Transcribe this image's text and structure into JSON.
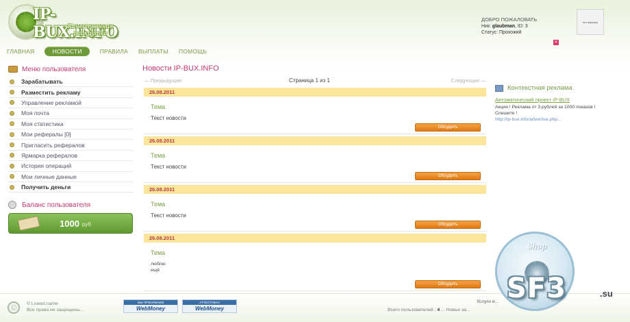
{
  "header": {
    "logo_text": "IP-BUX.INFO",
    "logo_tagline": "Качественная раскрутка",
    "welcome_title": "ДОБРО ПОЖАЛОВАТЬ",
    "user_line": [
      "Ник: ",
      "glaubman",
      ", ID: 3"
    ],
    "status_line": "Статус: Прохожий",
    "avatar_text": "нет аватара",
    "logout_symbol": "✕"
  },
  "nav": {
    "items": [
      "ГЛАВНАЯ",
      "НОВОСТИ",
      "ПРАВИЛА",
      "ВЫПЛАТЫ",
      "ПОМОЩЬ"
    ],
    "active_index": 1
  },
  "sidebar": {
    "menu_title": "Меню пользователя",
    "items": [
      {
        "label": "Зарабатывать",
        "bold": true
      },
      {
        "label": "Разместить рекламу",
        "bold": true
      },
      {
        "label": "Управление рекламой",
        "bold": false
      },
      {
        "label": "Моя почта",
        "bold": false
      },
      {
        "label": "Моя статистика",
        "bold": false
      },
      {
        "label": "Мои рефералы [0]",
        "bold": false
      },
      {
        "label": "Пригласить рефералов",
        "bold": false
      },
      {
        "label": "Ярмарка рефералов",
        "bold": false
      },
      {
        "label": "История операций",
        "bold": false
      },
      {
        "label": "Мои личные данные",
        "bold": false
      },
      {
        "label": "Получить деньги",
        "bold": true
      }
    ],
    "balance_title": "Баланс пользователя",
    "balance_amount": "1000",
    "balance_currency": "руб"
  },
  "main": {
    "title": "Новости IP-BUX.INFO",
    "pager": {
      "prev": "— Предыдущие",
      "current": "Страница 1 из 1",
      "next": "Следующие —"
    },
    "discuss_label": "Обсудить",
    "news": [
      {
        "date": "26.08.2011",
        "topic": "Тема",
        "text": [
          "Текст новости"
        ]
      },
      {
        "date": "26.08.2011",
        "topic": "Тема",
        "text": [
          "Текст новости"
        ]
      },
      {
        "date": "26.08.2011",
        "topic": "Тема",
        "text": [
          "Текст новости"
        ]
      },
      {
        "date": "26.08.2011",
        "topic": "Тема",
        "text": [
          "люблю",
          "ещё"
        ]
      }
    ]
  },
  "ads": {
    "title": "Контекстная реклама",
    "link": "Автоматический проект IP-BUX",
    "text": "Акция ! Реклама от 3 рублей за 1000 показов ! Спешите !",
    "url": "http://ip-bux.info/advertise.php..."
  },
  "badge": {
    "word": "Shop",
    "watermark": "SF3",
    "watermark_suffix": ".su"
  },
  "footer": {
    "copy_symbol": "©",
    "copy_line1": "© Lowed.name",
    "copy_line2": "Все права не защищены...",
    "wm1_top": "МЫ ПРИНИМАЕМ",
    "wm2_top": "АТТЕСТОВАН",
    "wm_text": "WebMoney",
    "services": "Услуги и...",
    "users_label": "Всего пользователей : ",
    "users_count": "4",
    "users_tail": " ... Новых за..."
  },
  "colors": {
    "accent_green": "#6e9a3a",
    "heading_pink": "#c03a70",
    "date_bar": "#fbe59a",
    "button_orange": "#df7a16"
  }
}
